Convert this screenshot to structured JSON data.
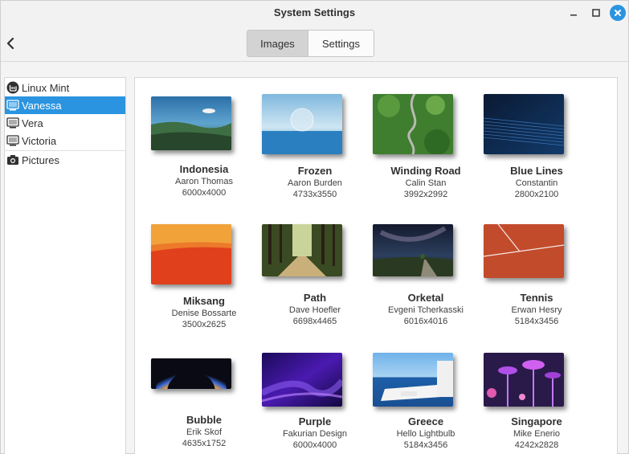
{
  "window": {
    "title": "System Settings"
  },
  "header": {
    "tabs": [
      {
        "label": "Images",
        "active": true
      },
      {
        "label": "Settings",
        "active": false
      }
    ]
  },
  "sidebar": {
    "items": [
      {
        "label": "Linux Mint",
        "icon": "mint-logo-icon",
        "selected": false
      },
      {
        "label": "Vanessa",
        "icon": "monitor-icon",
        "selected": true
      },
      {
        "label": "Vera",
        "icon": "monitor-icon",
        "selected": false
      },
      {
        "label": "Victoria",
        "icon": "monitor-icon",
        "selected": false
      },
      {
        "label": "Pictures",
        "icon": "camera-icon",
        "selected": false
      }
    ]
  },
  "wallpapers": [
    {
      "name": "Indonesia",
      "author": "Aaron Thomas",
      "size": "6000x4000"
    },
    {
      "name": "Frozen",
      "author": "Aaron Burden",
      "size": "4733x3550"
    },
    {
      "name": "Winding Road",
      "author": "Calin Stan",
      "size": "3992x2992"
    },
    {
      "name": "Blue Lines",
      "author": "Constantin",
      "size": "2800x2100"
    },
    {
      "name": "Miksang",
      "author": "Denise Bossarte",
      "size": "3500x2625"
    },
    {
      "name": "Path",
      "author": "Dave Hoefler",
      "size": "6698x4465"
    },
    {
      "name": "Orketal",
      "author": "Evgeni Tcherkasski",
      "size": "6016x4016"
    },
    {
      "name": "Tennis",
      "author": "Erwan Hesry",
      "size": "5184x3456"
    },
    {
      "name": "Bubble",
      "author": "Erik Skof",
      "size": "4635x1752"
    },
    {
      "name": "Purple",
      "author": "Fakurian Design",
      "size": "6000x4000"
    },
    {
      "name": "Greece",
      "author": "Hello Lightbulb",
      "size": "5184x3456"
    },
    {
      "name": "Singapore",
      "author": "Mike Enerio",
      "size": "4242x2828"
    }
  ],
  "colors": {
    "accent": "#2a94e0"
  }
}
